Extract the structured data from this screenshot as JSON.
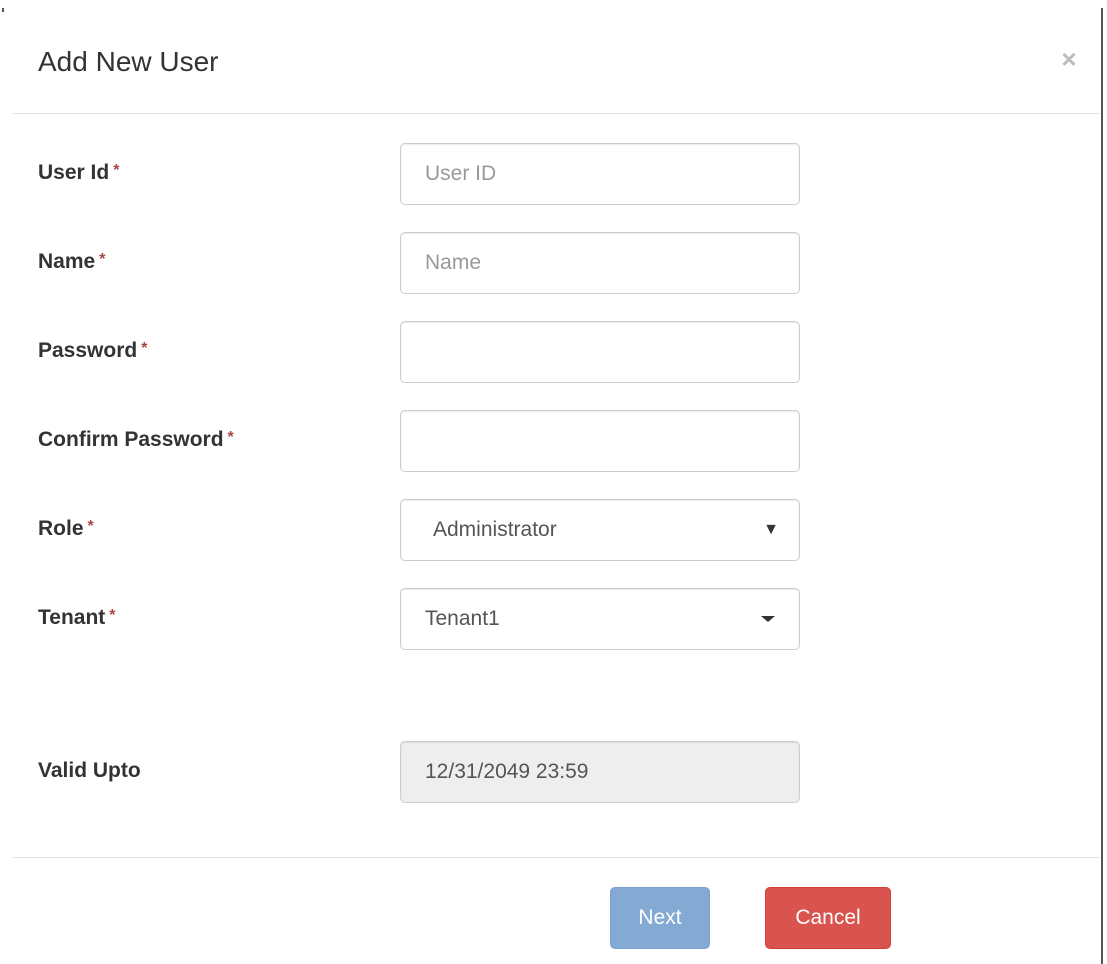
{
  "dialog": {
    "title": "Add New User",
    "close_symbol": "×"
  },
  "form": {
    "required_marker": "*",
    "user_id": {
      "label": "User Id",
      "value": "",
      "placeholder": "User ID"
    },
    "name": {
      "label": "Name",
      "value": "",
      "placeholder": "Name"
    },
    "password": {
      "label": "Password",
      "value": ""
    },
    "confirm_password": {
      "label": "Confirm Password",
      "value": ""
    },
    "role": {
      "label": "Role",
      "selected": "Administrator",
      "arrow": "▼"
    },
    "tenant": {
      "label": "Tenant",
      "selected": "Tenant1"
    },
    "valid_upto": {
      "label": "Valid Upto",
      "value": "12/31/2049 23:59"
    }
  },
  "footer": {
    "next_label": "Next",
    "cancel_label": "Cancel"
  },
  "colors": {
    "primary_disabled": "#84aad3",
    "danger": "#d9534f",
    "required": "#a94442",
    "readonly_bg": "#eeeeee"
  },
  "icons": {
    "close": "close-icon",
    "role_dropdown": "triangle-down-icon",
    "tenant_dropdown": "caret-down-icon"
  }
}
